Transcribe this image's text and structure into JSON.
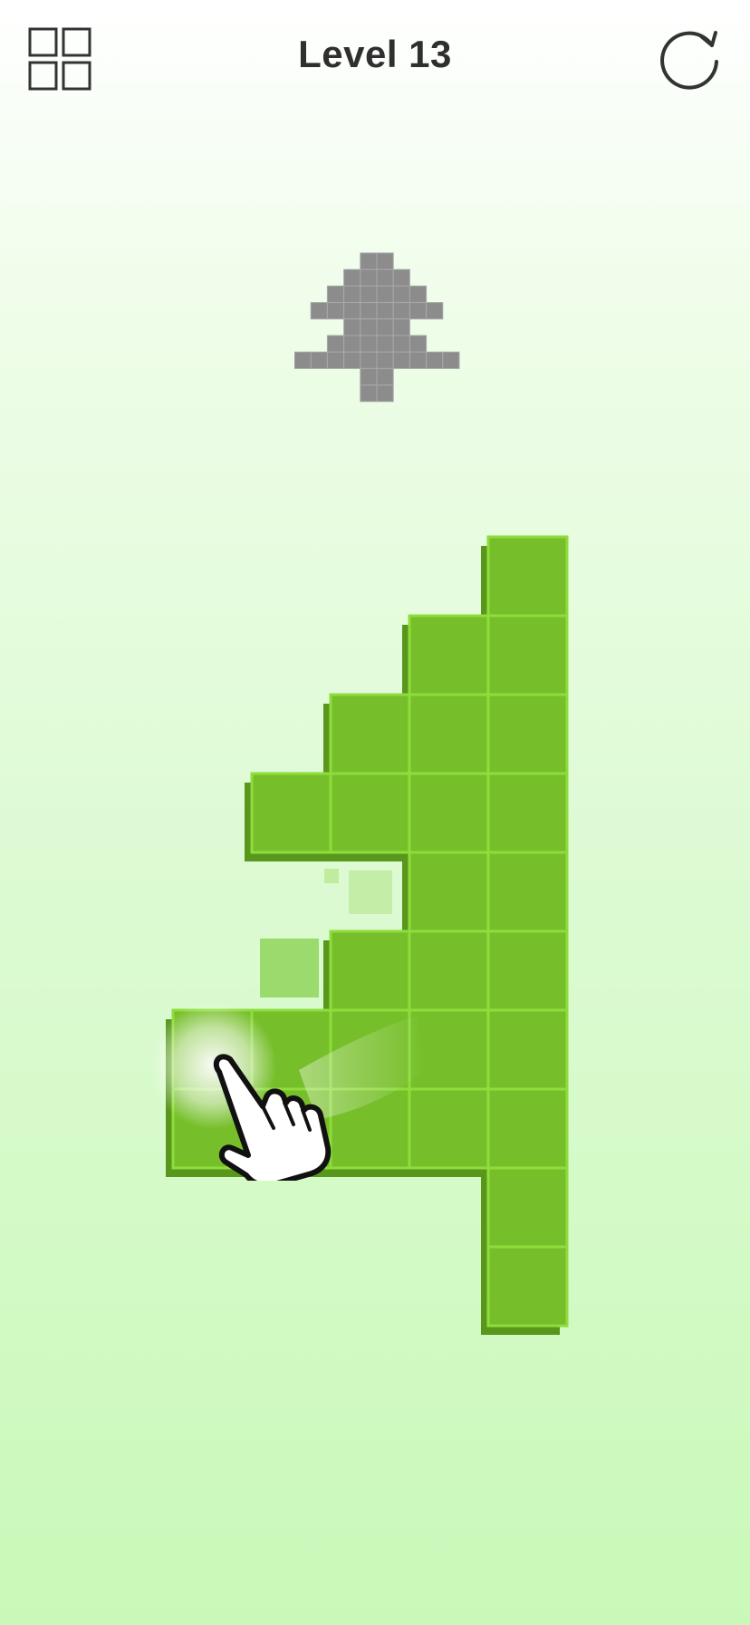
{
  "header": {
    "title": "Level 13",
    "levels_icon": "level-grid-icon",
    "restart_icon": "restart-icon"
  },
  "colors": {
    "tile": "#76bf2a",
    "tile_border": "#8fdc3c",
    "tile_shadow": "#58971c",
    "target_pixel": "#8c8c8c",
    "title": "#2f2f2f"
  },
  "target_pattern": [
    "....##....",
    "...####...",
    "..######..",
    ".########.",
    "...####...",
    "..######..",
    "##########",
    "....##....",
    "....##...."
  ],
  "board": {
    "description_icon": "tap-hand-icon",
    "columns": [
      {
        "col": 0,
        "rows": [
          6,
          7
        ]
      },
      {
        "col": 1,
        "rows": [
          3,
          6,
          7
        ]
      },
      {
        "col": 2,
        "rows": [
          2,
          3,
          5,
          6,
          7
        ]
      },
      {
        "col": 3,
        "rows": [
          1,
          2,
          3,
          4,
          5,
          6,
          7
        ]
      },
      {
        "col": 4,
        "rows": [
          0,
          1,
          2,
          3,
          4,
          5,
          6,
          7,
          8,
          9
        ]
      }
    ],
    "highlighted_tile": {
      "col": 0,
      "row": 6
    }
  }
}
